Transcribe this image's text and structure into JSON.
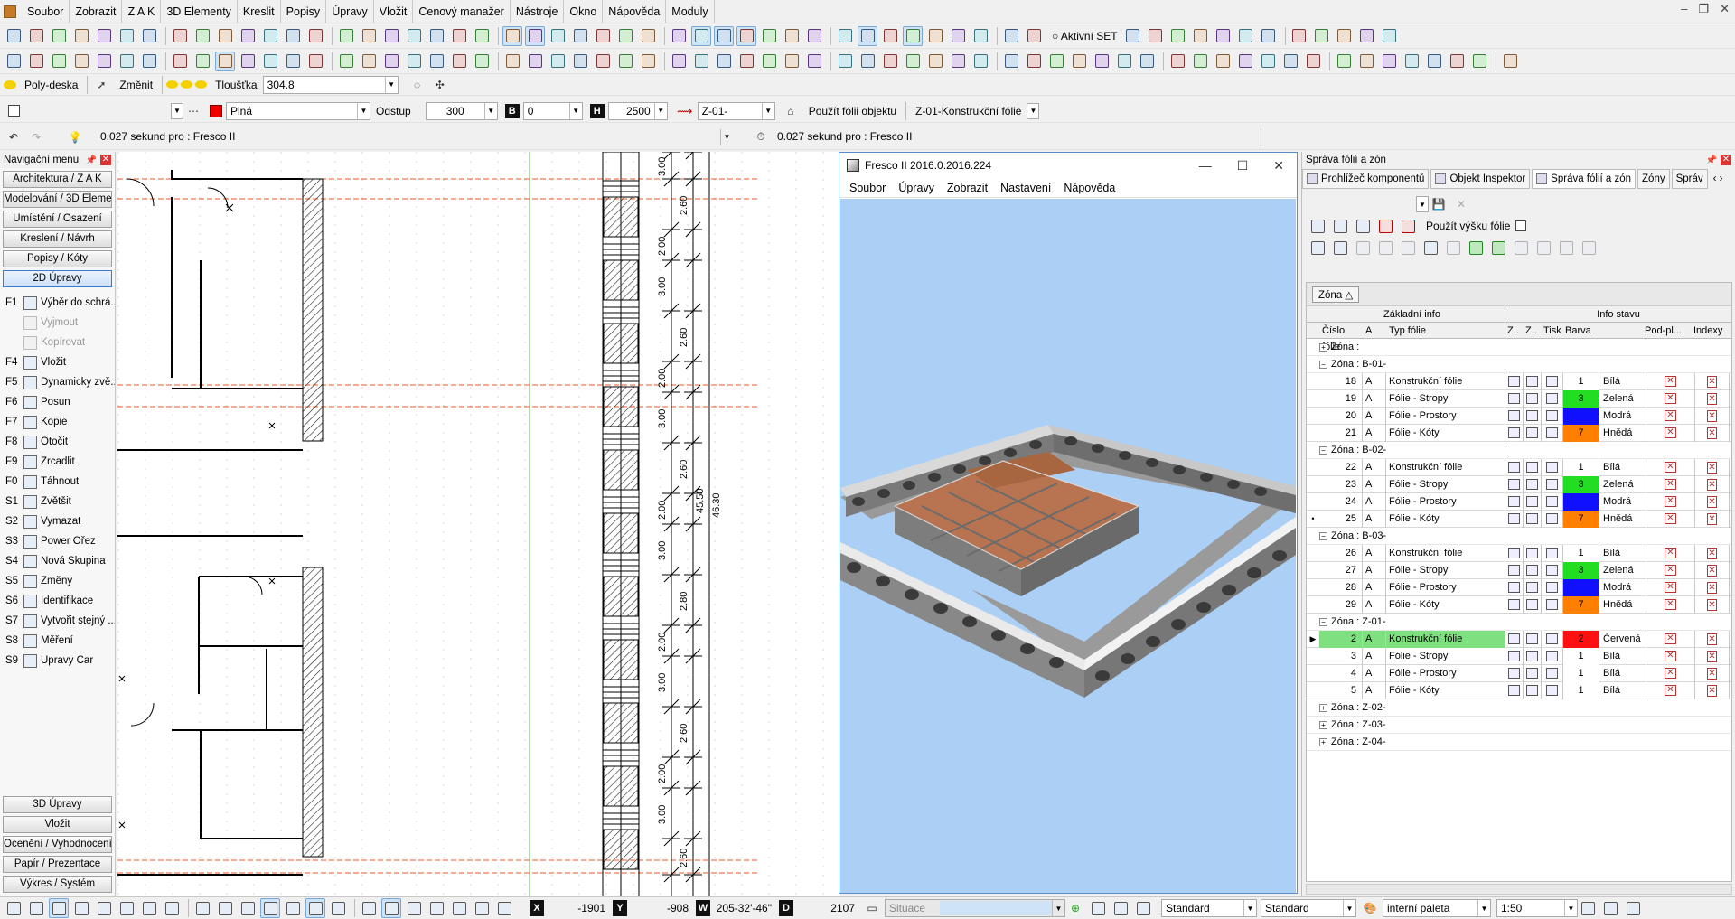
{
  "menubar": {
    "items": [
      "Soubor",
      "Zobrazit",
      "Z A K",
      "3D Elementy",
      "Kreslit",
      "Popisy",
      "Úpravy",
      "Vložit",
      "Cenový manažer",
      "Nástroje",
      "Okno",
      "Nápověda",
      "Moduly"
    ]
  },
  "toolbar1": {
    "aktivni_set_label": "Aktivní SET"
  },
  "toolbar3": {
    "tool_name": "Poly-deska",
    "zmenit_label": "Změnit",
    "tloustka_label": "Tloušťka",
    "tloustka_value": "304.8"
  },
  "toolbar4": {
    "fill_value": "Plná",
    "odstup_label": "Odstup",
    "odstup_value": "300",
    "b_value": "0",
    "h_value": "2500",
    "layer_value": "Z-01-",
    "use_layer_label": "Použít fólii objektu",
    "current_layer": "Z-01-Konstrukční fólie"
  },
  "toolbar5": {
    "status_left": "0.027 sekund pro : Fresco II",
    "status_right": "0.027 sekund pro : Fresco II"
  },
  "navpanel": {
    "title": "Navigační menu",
    "top_buttons": [
      "Architektura / Z A K",
      "Modelování / 3D Eleme...",
      "Umístění / Osazení",
      "Kreslení / Návrh",
      "Popisy / Kóty",
      "2D Úpravy"
    ],
    "functions": [
      {
        "key": "F1",
        "label": "Výběr do schrá...",
        "disabled": false
      },
      {
        "key": "",
        "label": "Vyjmout",
        "disabled": true
      },
      {
        "key": "",
        "label": "Kopírovat",
        "disabled": true
      },
      {
        "key": "F4",
        "label": "Vložit",
        "disabled": false
      },
      {
        "key": "F5",
        "label": "Dynamicky zvě...",
        "disabled": false
      },
      {
        "key": "F6",
        "label": "Posun",
        "disabled": false
      },
      {
        "key": "F7",
        "label": "Kopie",
        "disabled": false
      },
      {
        "key": "F8",
        "label": "Otočit",
        "disabled": false
      },
      {
        "key": "F9",
        "label": "Zrcadlit",
        "disabled": false
      },
      {
        "key": "F0",
        "label": "Táhnout",
        "disabled": false
      },
      {
        "key": "S1",
        "label": "Zvětšit",
        "disabled": false
      },
      {
        "key": "S2",
        "label": "Vymazat",
        "disabled": false
      },
      {
        "key": "S3",
        "label": "Power Ořez",
        "disabled": false
      },
      {
        "key": "S4",
        "label": "Nová Skupina",
        "disabled": false
      },
      {
        "key": "S5",
        "label": "Změny",
        "disabled": false
      },
      {
        "key": "S6",
        "label": "Identifikace",
        "disabled": false
      },
      {
        "key": "S7",
        "label": "Vytvořit stejný ...",
        "disabled": false
      },
      {
        "key": "S8",
        "label": "Měření",
        "disabled": false
      },
      {
        "key": "S9",
        "label": "Úpravy Čar",
        "disabled": false
      }
    ],
    "bottom_buttons": [
      "3D Úpravy",
      "Vložit",
      "Ocenění / Vyhodnocení",
      "Papír / Prezentace",
      "Výkres / Systém"
    ]
  },
  "drawing": {
    "dims": [
      "3.00",
      "2.60",
      "2.00",
      "3.00",
      "2.60",
      "2.00",
      "3.00",
      "2.60",
      "2.00",
      "3.00",
      "2.80",
      "2.00",
      "3.00",
      "2.60",
      "2.00",
      "3.00",
      "2.60"
    ],
    "total1": "45.50",
    "total2": "46.30"
  },
  "fresco": {
    "title": "Fresco II  2016.0.2016.224",
    "menu": [
      "Soubor",
      "Úpravy",
      "Zobrazit",
      "Nastavení",
      "Nápověda"
    ]
  },
  "rpanel": {
    "title": "Správa fólií a zón",
    "tabs": [
      "Prohlížeč komponentů",
      "Objekt Inspektor",
      "Správa fólií a zón",
      "Zóny",
      "Správ"
    ],
    "pouzit_label": "Použít výšku fólie",
    "group_chip": "Zóna",
    "hdr_basic": "Základní info",
    "hdr_state": "Info stavu",
    "cols": {
      "num": "Číslo fólie",
      "a": "A",
      "typ": "Typ fólie",
      "z1": "Z..",
      "z2": "Z..",
      "tisk": "Tisk",
      "barva": "Barva",
      "pod": "Pod-pl...",
      "idx": "Indexy"
    },
    "zones": [
      {
        "label": "Zóna :",
        "expanded": false,
        "rows": []
      },
      {
        "label": "Zóna : B-01-",
        "expanded": true,
        "rows": [
          {
            "num": "18",
            "a": "A",
            "typ": "Konstrukční fólie",
            "bar_num": "1",
            "bar_name": "Bílá",
            "color": "#ffffff"
          },
          {
            "num": "19",
            "a": "A",
            "typ": "Fólie - Stropy",
            "bar_num": "3",
            "bar_name": "Zelená",
            "color": "#22dd22"
          },
          {
            "num": "20",
            "a": "A",
            "typ": "Fólie - Prostory",
            "bar_num": "4",
            "bar_name": "Modrá",
            "color": "#1010ff"
          },
          {
            "num": "21",
            "a": "A",
            "typ": "Fólie - Kóty",
            "bar_num": "7",
            "bar_name": "Hnědá",
            "color": "#ff8000"
          }
        ]
      },
      {
        "label": "Zóna : B-02-",
        "expanded": true,
        "rows": [
          {
            "num": "22",
            "a": "A",
            "typ": "Konstrukční fólie",
            "bar_num": "1",
            "bar_name": "Bílá",
            "color": "#ffffff"
          },
          {
            "num": "23",
            "a": "A",
            "typ": "Fólie - Stropy",
            "bar_num": "3",
            "bar_name": "Zelená",
            "color": "#22dd22"
          },
          {
            "num": "24",
            "a": "A",
            "typ": "Fólie - Prostory",
            "bar_num": "4",
            "bar_name": "Modrá",
            "color": "#1010ff"
          },
          {
            "num": "25",
            "a": "A",
            "typ": "Fólie - Kóty",
            "bar_num": "7",
            "bar_name": "Hnědá",
            "color": "#ff8000"
          }
        ]
      },
      {
        "label": "Zóna : B-03-",
        "expanded": true,
        "rows": [
          {
            "num": "26",
            "a": "A",
            "typ": "Konstrukční fólie",
            "bar_num": "1",
            "bar_name": "Bílá",
            "color": "#ffffff"
          },
          {
            "num": "27",
            "a": "A",
            "typ": "Fólie - Stropy",
            "bar_num": "3",
            "bar_name": "Zelená",
            "color": "#22dd22"
          },
          {
            "num": "28",
            "a": "A",
            "typ": "Fólie - Prostory",
            "bar_num": "4",
            "bar_name": "Modrá",
            "color": "#1010ff"
          },
          {
            "num": "29",
            "a": "A",
            "typ": "Fólie - Kóty",
            "bar_num": "7",
            "bar_name": "Hnědá",
            "color": "#ff8000"
          }
        ]
      },
      {
        "label": "Zóna : Z-01-",
        "expanded": true,
        "rows": [
          {
            "num": "2",
            "a": "A",
            "typ": "Konstrukční fólie",
            "bar_num": "2",
            "bar_name": "Červená",
            "color": "#ff1010",
            "selected": true
          },
          {
            "num": "3",
            "a": "A",
            "typ": "Fólie - Stropy",
            "bar_num": "1",
            "bar_name": "Bílá",
            "color": "#ffffff"
          },
          {
            "num": "4",
            "a": "A",
            "typ": "Fólie - Prostory",
            "bar_num": "1",
            "bar_name": "Bílá",
            "color": "#ffffff"
          },
          {
            "num": "5",
            "a": "A",
            "typ": "Fólie - Kóty",
            "bar_num": "1",
            "bar_name": "Bílá",
            "color": "#ffffff"
          }
        ]
      },
      {
        "label": "Zóna : Z-02-",
        "expanded": false,
        "rows": []
      },
      {
        "label": "Zóna : Z-03-",
        "expanded": false,
        "rows": []
      },
      {
        "label": "Zóna : Z-04-",
        "expanded": false,
        "rows": []
      }
    ]
  },
  "statusbar": {
    "x_label": "X",
    "x_value": "-1901",
    "y_label": "Y",
    "y_value": "-908",
    "w_label": "W",
    "w_value": "205-32'-46\"",
    "d_label": "D",
    "d_value": "2107",
    "situace": "Situace",
    "std1": "Standard",
    "std2": "Standard",
    "palette": "interní paleta",
    "scale": "1:50"
  }
}
